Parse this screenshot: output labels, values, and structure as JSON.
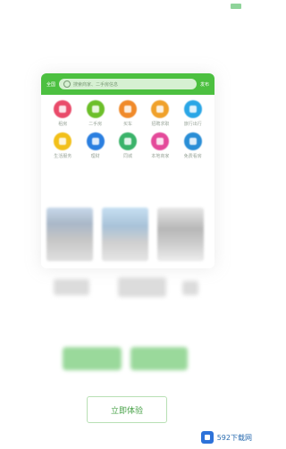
{
  "app_preview": {
    "city": "全国",
    "search_placeholder": "搜索商家、二手房信息",
    "post_label": "发布",
    "grid": [
      {
        "label": "租房",
        "color": "#e94b6a",
        "icon": "house-icon"
      },
      {
        "label": "二手房",
        "color": "#6cbf2a",
        "icon": "building-icon"
      },
      {
        "label": "买车",
        "color": "#f08a2a",
        "icon": "car-icon"
      },
      {
        "label": "招聘求职",
        "color": "#f0a12a",
        "icon": "briefcase-icon"
      },
      {
        "label": "旅行出行",
        "color": "#2aa6e6",
        "icon": "plane-icon"
      },
      {
        "label": "生活服务",
        "color": "#f2c01a",
        "icon": "service-icon"
      },
      {
        "label": "理财",
        "color": "#2b7fe0",
        "icon": "chart-icon"
      },
      {
        "label": "同城",
        "color": "#3bb36a",
        "icon": "map-icon"
      },
      {
        "label": "本地商家",
        "color": "#e44a9a",
        "icon": "search-icon"
      },
      {
        "label": "免费看房",
        "color": "#2a8ed6",
        "icon": "video-icon"
      }
    ]
  },
  "cta_label": "立即体验",
  "watermark": "592下载网"
}
